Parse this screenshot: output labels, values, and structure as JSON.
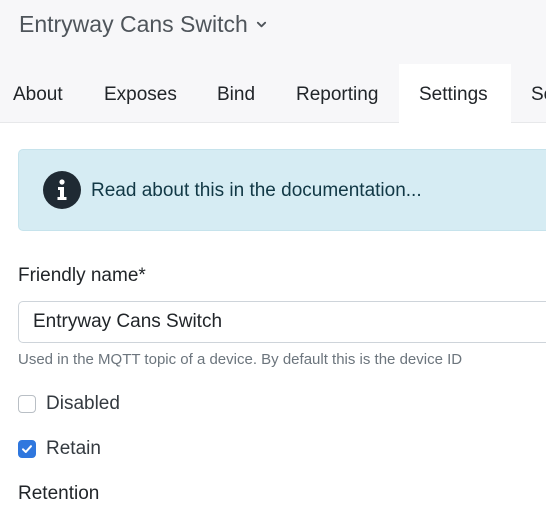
{
  "header": {
    "device_title": "Entryway Cans Switch"
  },
  "tabs": [
    {
      "label": "About"
    },
    {
      "label": "Exposes"
    },
    {
      "label": "Bind"
    },
    {
      "label": "Reporting"
    },
    {
      "label": "Settings",
      "active": true
    },
    {
      "label": "Se"
    }
  ],
  "alert": {
    "link_text": "Read about this in the documentation..."
  },
  "form": {
    "friendly_name_label": "Friendly name*",
    "friendly_name_value": "Entryway Cans Switch",
    "friendly_name_hint": "Used in the MQTT topic of a device. By default this is the device ID",
    "disabled_label": "Disabled",
    "disabled_checked": false,
    "retain_label": "Retain",
    "retain_checked": true,
    "retention_label": "Retention"
  },
  "colors": {
    "accent": "#2f77de",
    "alert_bg": "#d6ecf3",
    "alert_text": "#113845",
    "header_bg": "#f7f7f9"
  }
}
